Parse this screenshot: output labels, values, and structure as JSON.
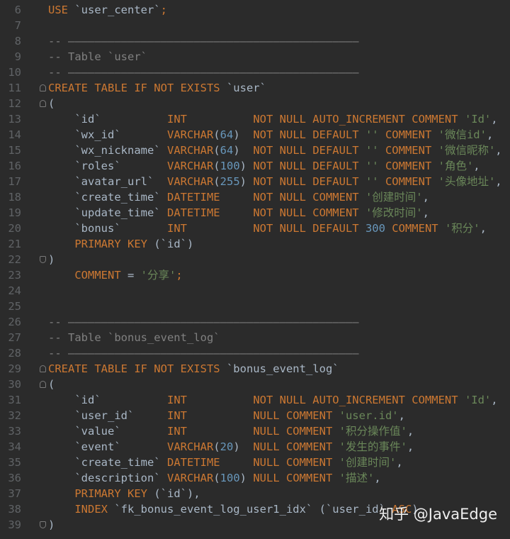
{
  "editor": {
    "lines": [
      {
        "n": "6",
        "fold": "",
        "tokens": [
          [
            "kw",
            "USE "
          ],
          [
            "id",
            "`user_center`"
          ],
          [
            "kw",
            ";"
          ]
        ]
      },
      {
        "n": "7",
        "fold": "",
        "tokens": []
      },
      {
        "n": "8",
        "fold": "",
        "tokens": [
          [
            "cmt",
            "-- ————————————————————————————————————————————"
          ]
        ]
      },
      {
        "n": "9",
        "fold": "",
        "tokens": [
          [
            "cmt",
            "-- Table `user`"
          ]
        ]
      },
      {
        "n": "10",
        "fold": "",
        "tokens": [
          [
            "cmt",
            "-- ————————————————————————————————————————————"
          ]
        ]
      },
      {
        "n": "11",
        "fold": "start",
        "tokens": [
          [
            "kw",
            "CREATE TABLE IF NOT EXISTS "
          ],
          [
            "id",
            "`user`"
          ]
        ]
      },
      {
        "n": "12",
        "fold": "start",
        "tokens": [
          [
            "plain",
            "("
          ]
        ]
      },
      {
        "n": "13",
        "fold": "",
        "tokens": [
          [
            "plain",
            "    "
          ],
          [
            "id",
            "`id`          "
          ],
          [
            "kw",
            "INT          "
          ],
          [
            "kw",
            "NOT NULL AUTO_INCREMENT COMMENT "
          ],
          [
            "str",
            "'Id'"
          ],
          [
            "plain",
            ","
          ]
        ]
      },
      {
        "n": "14",
        "fold": "",
        "tokens": [
          [
            "plain",
            "    "
          ],
          [
            "id",
            "`wx_id`       "
          ],
          [
            "kw",
            "VARCHAR"
          ],
          [
            "plain",
            "("
          ],
          [
            "num",
            "64"
          ],
          [
            "plain",
            ")  "
          ],
          [
            "kw",
            "NOT NULL DEFAULT "
          ],
          [
            "str",
            "'' "
          ],
          [
            "kw",
            "COMMENT "
          ],
          [
            "str",
            "'微信id'"
          ],
          [
            "plain",
            ","
          ]
        ]
      },
      {
        "n": "15",
        "fold": "",
        "tokens": [
          [
            "plain",
            "    "
          ],
          [
            "id",
            "`wx_nickname` "
          ],
          [
            "kw",
            "VARCHAR"
          ],
          [
            "plain",
            "("
          ],
          [
            "num",
            "64"
          ],
          [
            "plain",
            ")  "
          ],
          [
            "kw",
            "NOT NULL DEFAULT "
          ],
          [
            "str",
            "'' "
          ],
          [
            "kw",
            "COMMENT "
          ],
          [
            "str",
            "'微信昵称'"
          ],
          [
            "plain",
            ","
          ]
        ]
      },
      {
        "n": "16",
        "fold": "",
        "tokens": [
          [
            "plain",
            "    "
          ],
          [
            "id",
            "`roles`       "
          ],
          [
            "kw",
            "VARCHAR"
          ],
          [
            "plain",
            "("
          ],
          [
            "num",
            "100"
          ],
          [
            "plain",
            ") "
          ],
          [
            "kw",
            "NOT NULL DEFAULT "
          ],
          [
            "str",
            "'' "
          ],
          [
            "kw",
            "COMMENT "
          ],
          [
            "str",
            "'角色'"
          ],
          [
            "plain",
            ","
          ]
        ]
      },
      {
        "n": "17",
        "fold": "",
        "tokens": [
          [
            "plain",
            "    "
          ],
          [
            "id",
            "`avatar_url`  "
          ],
          [
            "kw",
            "VARCHAR"
          ],
          [
            "plain",
            "("
          ],
          [
            "num",
            "255"
          ],
          [
            "plain",
            ") "
          ],
          [
            "kw",
            "NOT NULL DEFAULT "
          ],
          [
            "str",
            "'' "
          ],
          [
            "kw",
            "COMMENT "
          ],
          [
            "str",
            "'头像地址'"
          ],
          [
            "plain",
            ","
          ]
        ]
      },
      {
        "n": "18",
        "fold": "",
        "tokens": [
          [
            "plain",
            "    "
          ],
          [
            "id",
            "`create_time` "
          ],
          [
            "kw",
            "DATETIME     "
          ],
          [
            "kw",
            "NOT NULL COMMENT "
          ],
          [
            "str",
            "'创建时间'"
          ],
          [
            "plain",
            ","
          ]
        ]
      },
      {
        "n": "19",
        "fold": "",
        "tokens": [
          [
            "plain",
            "    "
          ],
          [
            "id",
            "`update_time` "
          ],
          [
            "kw",
            "DATETIME     "
          ],
          [
            "kw",
            "NOT NULL COMMENT "
          ],
          [
            "str",
            "'修改时间'"
          ],
          [
            "plain",
            ","
          ]
        ]
      },
      {
        "n": "20",
        "fold": "",
        "tokens": [
          [
            "plain",
            "    "
          ],
          [
            "id",
            "`bonus`       "
          ],
          [
            "kw",
            "INT          "
          ],
          [
            "kw",
            "NOT NULL DEFAULT "
          ],
          [
            "num",
            "300"
          ],
          [
            "kw",
            " COMMENT "
          ],
          [
            "str",
            "'积分'"
          ],
          [
            "plain",
            ","
          ]
        ]
      },
      {
        "n": "21",
        "fold": "",
        "tokens": [
          [
            "plain",
            "    "
          ],
          [
            "kw",
            "PRIMARY KEY "
          ],
          [
            "plain",
            "("
          ],
          [
            "id",
            "`id`"
          ],
          [
            "plain",
            ")"
          ]
        ]
      },
      {
        "n": "22",
        "fold": "end",
        "tokens": [
          [
            "plain",
            ")"
          ]
        ]
      },
      {
        "n": "23",
        "fold": "",
        "tokens": [
          [
            "plain",
            "    "
          ],
          [
            "kw",
            "COMMENT "
          ],
          [
            "plain",
            "= "
          ],
          [
            "str",
            "'分享'"
          ],
          [
            "kw",
            ";"
          ]
        ]
      },
      {
        "n": "24",
        "fold": "",
        "tokens": []
      },
      {
        "n": "25",
        "fold": "",
        "tokens": []
      },
      {
        "n": "26",
        "fold": "",
        "tokens": [
          [
            "cmt",
            "-- ————————————————————————————————————————————"
          ]
        ]
      },
      {
        "n": "27",
        "fold": "",
        "tokens": [
          [
            "cmt",
            "-- Table `bonus_event_log`"
          ]
        ]
      },
      {
        "n": "28",
        "fold": "",
        "tokens": [
          [
            "cmt",
            "-- ————————————————————————————————————————————"
          ]
        ]
      },
      {
        "n": "29",
        "fold": "start",
        "tokens": [
          [
            "kw",
            "CREATE TABLE IF NOT EXISTS "
          ],
          [
            "id",
            "`bonus_event_log`"
          ]
        ]
      },
      {
        "n": "30",
        "fold": "start",
        "tokens": [
          [
            "plain",
            "("
          ]
        ]
      },
      {
        "n": "31",
        "fold": "",
        "tokens": [
          [
            "plain",
            "    "
          ],
          [
            "id",
            "`id`          "
          ],
          [
            "kw",
            "INT          "
          ],
          [
            "kw",
            "NOT NULL AUTO_INCREMENT COMMENT "
          ],
          [
            "str",
            "'Id'"
          ],
          [
            "plain",
            ","
          ]
        ]
      },
      {
        "n": "32",
        "fold": "",
        "tokens": [
          [
            "plain",
            "    "
          ],
          [
            "id",
            "`user_id`     "
          ],
          [
            "kw",
            "INT          "
          ],
          [
            "kw",
            "NULL COMMENT "
          ],
          [
            "str",
            "'user.id'"
          ],
          [
            "plain",
            ","
          ]
        ]
      },
      {
        "n": "33",
        "fold": "",
        "tokens": [
          [
            "plain",
            "    "
          ],
          [
            "id",
            "`value`       "
          ],
          [
            "kw",
            "INT          "
          ],
          [
            "kw",
            "NULL COMMENT "
          ],
          [
            "str",
            "'积分操作值'"
          ],
          [
            "plain",
            ","
          ]
        ]
      },
      {
        "n": "34",
        "fold": "",
        "tokens": [
          [
            "plain",
            "    "
          ],
          [
            "id",
            "`event`       "
          ],
          [
            "kw",
            "VARCHAR"
          ],
          [
            "plain",
            "("
          ],
          [
            "num",
            "20"
          ],
          [
            "plain",
            ")  "
          ],
          [
            "kw",
            "NULL COMMENT "
          ],
          [
            "str",
            "'发生的事件'"
          ],
          [
            "plain",
            ","
          ]
        ]
      },
      {
        "n": "35",
        "fold": "",
        "tokens": [
          [
            "plain",
            "    "
          ],
          [
            "id",
            "`create_time` "
          ],
          [
            "kw",
            "DATETIME     "
          ],
          [
            "kw",
            "NULL COMMENT "
          ],
          [
            "str",
            "'创建时间'"
          ],
          [
            "plain",
            ","
          ]
        ]
      },
      {
        "n": "36",
        "fold": "",
        "tokens": [
          [
            "plain",
            "    "
          ],
          [
            "id",
            "`description` "
          ],
          [
            "kw",
            "VARCHAR"
          ],
          [
            "plain",
            "("
          ],
          [
            "num",
            "100"
          ],
          [
            "plain",
            ") "
          ],
          [
            "kw",
            "NULL COMMENT "
          ],
          [
            "str",
            "'描述'"
          ],
          [
            "plain",
            ","
          ]
        ]
      },
      {
        "n": "37",
        "fold": "",
        "tokens": [
          [
            "plain",
            "    "
          ],
          [
            "kw",
            "PRIMARY KEY "
          ],
          [
            "plain",
            "("
          ],
          [
            "id",
            "`id`"
          ],
          [
            "plain",
            "),"
          ]
        ]
      },
      {
        "n": "38",
        "fold": "",
        "tokens": [
          [
            "plain",
            "    "
          ],
          [
            "kw",
            "INDEX "
          ],
          [
            "id",
            "`fk_bonus_event_log_user1_idx` "
          ],
          [
            "plain",
            "("
          ],
          [
            "id",
            "`user_id` "
          ],
          [
            "kw",
            "ASC"
          ],
          [
            "plain",
            ")"
          ]
        ]
      },
      {
        "n": "39",
        "fold": "end",
        "tokens": [
          [
            "plain",
            ")"
          ]
        ]
      }
    ]
  },
  "watermark": {
    "text": "知乎 @JavaEdge"
  },
  "colors": {
    "background": "#2b2b2b",
    "keyword": "#cc7832",
    "string": "#6a8759",
    "number": "#6897bb",
    "comment": "#808080",
    "text": "#a9b7c6",
    "gutter": "#606366"
  }
}
